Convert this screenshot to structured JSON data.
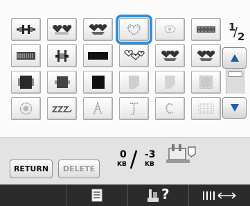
{
  "page": {
    "current": "1",
    "total": "2"
  },
  "controls": {
    "return_label": "RETURN",
    "delete_label": "DELETE"
  },
  "memory": {
    "used_value": "0",
    "used_unit": "KB",
    "remaining_value": "-3",
    "remaining_unit": "KB"
  },
  "footer": {
    "help_label": "?"
  },
  "tiles": [
    "hearts-border-icon",
    "hearts-chain-icon",
    "hearts-ribbon-icon",
    "lace-heart-icon",
    "lace-motif-icon",
    "bar-border-icon",
    "bar-border-icon",
    "h-bar-icon",
    "black-bar-icon",
    "outline-hearts-icon",
    "hearts-ribbon-icon",
    "hearts-ribbon-icon",
    "dark-square-icon",
    "dark-square-icon",
    "dark-square-icon",
    "gray-swatch-icon",
    "gray-swatch-icon",
    "gray-swatch-icon",
    "lace-circle-icon",
    "script-letters-icon",
    "lace-letter-icon",
    "lace-letter-icon",
    "lace-letter-icon",
    "lace-pattern-icon"
  ],
  "colors": {
    "selection": "#2f8fe0",
    "footer_bg": "#2b2b2b"
  }
}
